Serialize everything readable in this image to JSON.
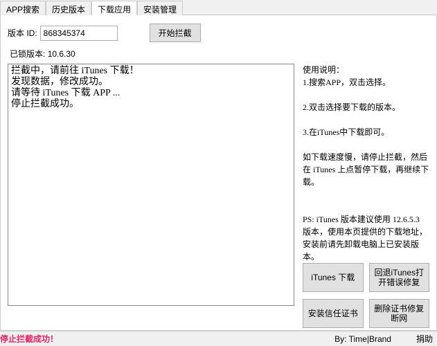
{
  "tabs": {
    "items": [
      {
        "label": "APP搜索",
        "active": false
      },
      {
        "label": "历史版本",
        "active": false
      },
      {
        "label": "下载应用",
        "active": true
      },
      {
        "label": "安装管理",
        "active": false
      }
    ]
  },
  "form": {
    "version_id_label": "版本 ID:",
    "version_id_value": "868345374",
    "start_btn": "开始拦截",
    "locked_label": "已锁版本:",
    "locked_value": "10.6.30"
  },
  "log_text": "拦截中，请前往 iTunes 下载！\n发现数据，修改成功。\n请等待 iTunes 下载 APP ...\n停止拦截成功。",
  "instructions_text": "使用说明：\n1.搜索APP，双击选择。\n\n2.双击选择要下载的版本。\n\n3.在iTunes中下载即可。\n\n如下载速度慢，请停止拦截，然后在 iTunes 上点暂停下载，再继续下载。\n\n\nPS: iTunes 版本建议使用 12.6.5.3 版本，使用本页提供的下载地址，安装前请先卸载电脑上已安装版本。",
  "side_buttons": {
    "itunes_download": "iTunes 下载",
    "rollback_fix": "回退iTunes打开错误修复",
    "trust_cert": "安装信任证书",
    "remove_cert": "删除证书修复断网"
  },
  "footer": {
    "status": "停止拦截成功！",
    "credit": "By: Time|Brand",
    "donate": "捐助"
  }
}
